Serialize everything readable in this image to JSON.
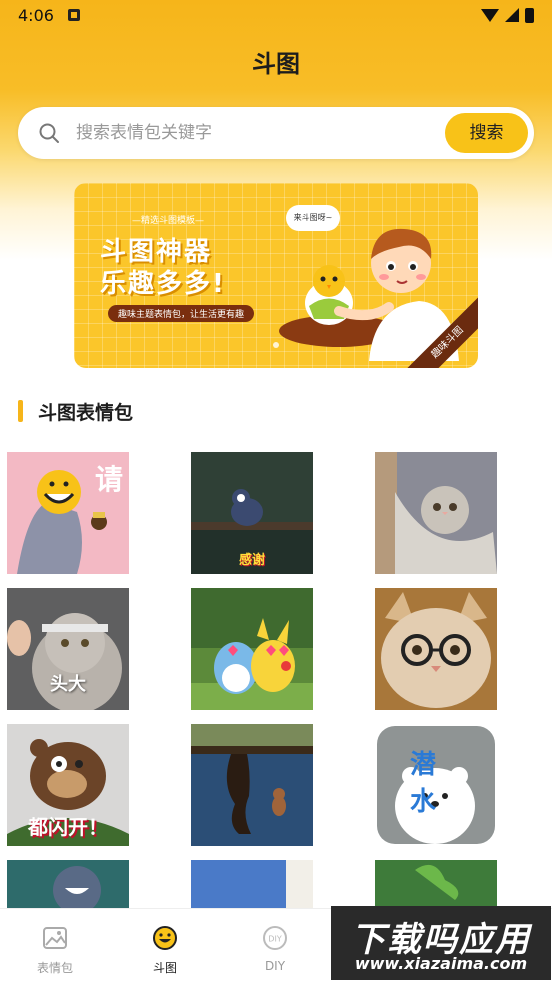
{
  "status": {
    "time": "4:06"
  },
  "header": {
    "title": "斗图"
  },
  "search": {
    "placeholder": "搜索表情包关键字",
    "button_label": "搜索"
  },
  "banner": {
    "subtitle": "—精选斗图模板—",
    "line1": "斗图神器",
    "line2": "乐趣多多!",
    "tagline": "趣味主题表情包，让生活更有趣",
    "bubble": "来斗图呀~",
    "ribbon": "趣味斗图"
  },
  "section": {
    "title": "斗图表情包"
  },
  "stickers": [
    {
      "name": "tom-please",
      "caption": "请"
    },
    {
      "name": "tom-thanks",
      "caption": "感谢"
    },
    {
      "name": "cat-hammock",
      "caption": ""
    },
    {
      "name": "cat-big-head",
      "caption": "头大"
    },
    {
      "name": "pokemon-love",
      "caption": ""
    },
    {
      "name": "cat-glasses",
      "caption": ""
    },
    {
      "name": "bear-open",
      "caption": "都闪开！"
    },
    {
      "name": "jerry-table",
      "caption": ""
    },
    {
      "name": "bear-dive",
      "caption": "潜 水"
    },
    {
      "name": "tom-partial",
      "caption": ""
    },
    {
      "name": "blue-partial",
      "caption": ""
    },
    {
      "name": "frog-partial",
      "caption": ""
    }
  ],
  "tabs": [
    {
      "label": "表情包",
      "icon": "image-icon"
    },
    {
      "label": "斗图",
      "icon": "smile-icon"
    },
    {
      "label": "DIY",
      "icon": "diy-icon"
    }
  ],
  "watermark": {
    "text": "下载吗应用",
    "url": "www.xiazaima.com"
  }
}
